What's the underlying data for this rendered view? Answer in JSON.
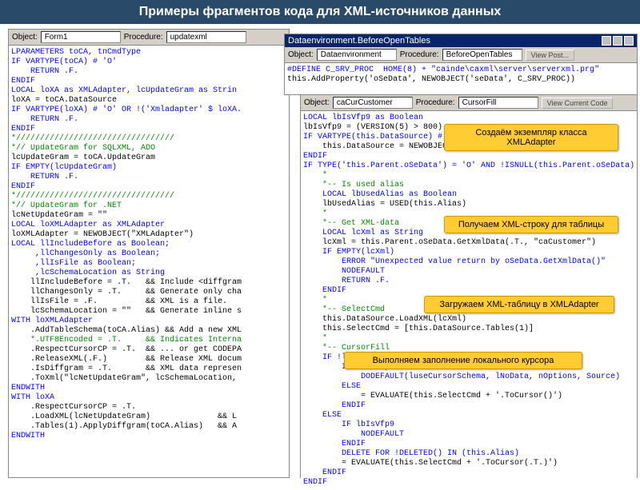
{
  "slide_title": "Примеры фрагментов кода для XML-источников данных",
  "p1": {
    "tb": {
      "obj_lbl": "Object:",
      "obj": "Form1",
      "proc_lbl": "Procedure:",
      "proc": "updatexml"
    }
  },
  "p2": {
    "title": "Dataenvironment.BeforeOpenTables",
    "tb": {
      "obj_lbl": "Object:",
      "obj": "Dataenvironment",
      "proc_lbl": "Procedure:",
      "proc": "BeforeOpenTables",
      "btn": "View Post..."
    }
  },
  "p3": {
    "tb": {
      "obj_lbl": "Object:",
      "obj": "caCurCustomer",
      "proc_lbl": "Procedure:",
      "proc": "CursorFill",
      "btn": "View Current Code"
    }
  },
  "code1": {
    "l1": "LPARAMETERS toCA, tnCmdType",
    "l2": "IF VARTYPE(toCA) # 'O'",
    "l3": "    RETURN .F.",
    "l4": "ENDIF",
    "l5": "LOCAL loXA as XMLAdapter, lcUpdateGram as Strin",
    "l6": "loXA = toCA.DataSource",
    "l7": "IF VARTYPE(loXA) # 'O' OR !('Xmladapter' $ loXA.",
    "l8": "    RETURN .F.",
    "l9": "ENDIF",
    "l10": "*/////////////////////////////////",
    "l11": "*// UpdateGram for SQLXML, ADO",
    "l12": "lcUpdateGram = toCA.UpdateGram",
    "l13": "IF EMPTY(lcUpdateGram)",
    "l14": "    RETURN .F.",
    "l15": "ENDIF",
    "l16": "*/////////////////////////////////",
    "l17": "*// UpdateGram for .NET",
    "l18": "lcNetUpdateGram = \"\"",
    "l19": "LOCAL loXMLAdapter as XMLAdapter",
    "l20": "loXMLAdapter = NEWOBJECT(\"XMLAdapter\")",
    "l21": "LOCAL llIncludeBefore as Boolean;",
    "l22": "     ,llChangesOnly as Boolean;",
    "l23": "     ,llIsFile as Boolean;",
    "l24": "     ,lcSchemaLocation as String",
    "l25": "    llIncludeBefore = .T.   && Include <diffgram",
    "l26": "    llChangesOnly = .T.     && Generate only cha",
    "l27": "    llIsFile = .F.          && XML is a file.",
    "l28": "    lcSchemaLocation = \"\"   && Generate inline s",
    "l29": "WITH loXMLAdapter",
    "l30": "    .AddTableSchema(toCA.Alias) && Add a new XML",
    "l31": "    *.UTF8Encoded = .T.     && Indicates Interna",
    "l32": "    .RespectCursorCP = .T.  && ... or get CODEPA",
    "l33": "    .ReleaseXML(.F.)        && Release XML docum",
    "l34": "    .IsDiffgram = .T.       && XML data represen",
    "l35": "    .ToXml(\"lcNetUpdateGram\", lcSchemaLocation,",
    "l36": "ENDWITH",
    "l37": "WITH loXA",
    "l38": "    .RespectCursorCP = .T.",
    "l39": "    .LoadXML(lcNetUpdateGram)              && L",
    "l40": "    .Tables(1).ApplyDiffgram(toCA.Alias)   && A",
    "l41": "ENDWITH"
  },
  "code2": {
    "l1": "#DEFINE C_SRV_PROC  HOME(8) + \"cainde\\caxml\\server\\serverxml.prg\"",
    "l2": "this.AddProperty('oSeData', NEWOBJECT('seData', C_SRV_PROC))"
  },
  "code3": {
    "l1": "LOCAL lbIsVfp9 as Boolean",
    "l2": "lbIsVfp9 = (VERSION(5) > 800)",
    "l3": "IF VARTYPE(this.DataSource) # 'O'",
    "l4": "    this.DataSource = NEWOBJECT('Xmladapter')",
    "l5": "ENDIF",
    "l6": "IF TYPE('this.Parent.oSeData') = 'O' AND !ISNULL(this.Parent.oSeData)",
    "l7": "    *",
    "l8": "    *-- Is used alias",
    "l9": "    LOCAL lbUsedAlias as Boolean",
    "l10": "    lbUsedAlias = USED(this.Alias)",
    "l11": "    *",
    "l12": "    *-- Get XML-data",
    "l13": "    LOCAL lcXml as String",
    "l14": "    lcXml = this.Parent.oSeData.GetXmlData(.T., \"caCustomer\")",
    "l15": "    IF EMPTY(lcXml)",
    "l16": "        ERROR \"Unexpected value return by oSeData.GetXmlData()\"",
    "l17": "        NODEFAULT",
    "l18": "        RETURN .F.",
    "l19": "    ENDIF",
    "l20": "    *",
    "l21": "    *-- SelectCmd",
    "l22": "    this.DataSource.LoadXML(lcXml)",
    "l23": "    this.SelectCmd = [this.DataSource.Tables(1)]",
    "l24": "    *",
    "l25": "    *-- CursorFill",
    "l26": "    IF !lbUsedAlias",
    "l27": "        IF lbIsVfp9",
    "l28": "            DODEFAULT(luseCursorSchema, lNoData, nOptions, Source)",
    "l29": "        ELSE",
    "l30": "            = EVALUATE(this.SelectCmd + '.ToCursor()')",
    "l31": "        ENDIF",
    "l32": "    ELSE",
    "l33": "        IF lbIsVfp9",
    "l34": "            NODEFAULT",
    "l35": "        ENDIF",
    "l36": "        DELETE FOR !DELETED() IN (this.Alias)",
    "l37": "        = EVALUATE(this.SelectCmd + '.ToCursor(.T.)')",
    "l38": "    ENDIF",
    "l39": "ENDIF"
  },
  "callouts": {
    "c1": "Создаём экземпляр класса XMLAdapter",
    "c2": "Получаем XML-строку для таблицы",
    "c3": "Загружаем XML-таблицу в XMLAdapter",
    "c4": "Выполняем заполнение локального курсора"
  }
}
